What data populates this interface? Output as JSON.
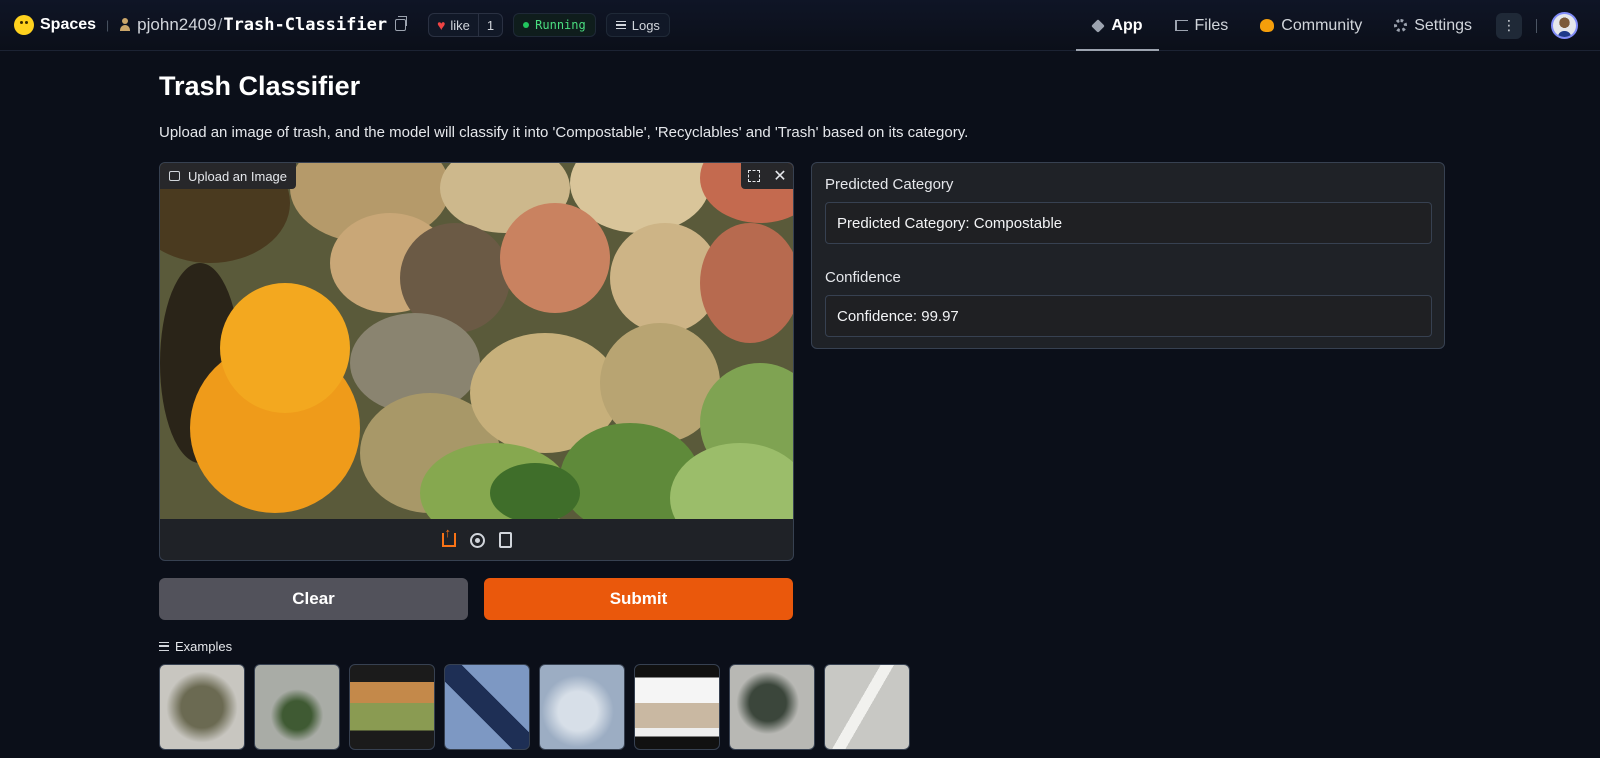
{
  "header": {
    "brand": "Spaces",
    "owner": "pjohn2409",
    "slash": "/",
    "repo": "Trash-Classifier",
    "like_label": "like",
    "like_count": "1",
    "status": "Running",
    "logs_label": "Logs",
    "tabs": [
      {
        "label": "App",
        "icon": "cube-icon",
        "active": true
      },
      {
        "label": "Files",
        "icon": "files-icon",
        "active": false
      },
      {
        "label": "Community",
        "icon": "community-icon",
        "active": false
      },
      {
        "label": "Settings",
        "icon": "gear-icon",
        "active": false
      }
    ],
    "more_label": "⋮"
  },
  "main": {
    "title": "Trash Classifier",
    "description": "Upload an image of trash, and the model will classify it into 'Compostable', 'Recyclables' and 'Trash' based on its category.",
    "upload_label": "Upload an Image",
    "close_glyph": "✕",
    "clear_label": "Clear",
    "submit_label": "Submit",
    "examples_label": "Examples"
  },
  "output": {
    "category_label": "Predicted Category",
    "category_value": "Predicted Category: Compostable",
    "confidence_label": "Confidence",
    "confidence_value": "Confidence: 99.97"
  },
  "colors": {
    "accent": "#ea580c",
    "running": "#22c55e",
    "background": "#0b0f19"
  }
}
